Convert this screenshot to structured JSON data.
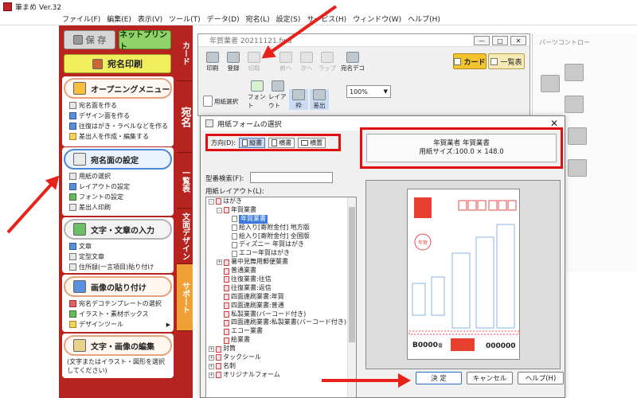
{
  "app": {
    "title": "筆まめ Ver.32"
  },
  "menu": [
    "ファイル(F)",
    "編集(E)",
    "表示(V)",
    "ツール(T)",
    "データ(D)",
    "宛名(L)",
    "設定(S)",
    "サービス(H)",
    "ウィンドウ(W)",
    "ヘルプ(H)"
  ],
  "left_panel": {
    "save_label": "保 存",
    "netprint_label": "ネットプリント",
    "address_print_label": "宛名印刷",
    "sections": [
      {
        "header": "オープニングメニュー",
        "items": [
          "宛名面を作る",
          "デザイン面を作る",
          "往復はがき・ラベルなどを作る",
          "差出人を作成・編集する"
        ]
      },
      {
        "header": "宛名面の設定",
        "items": [
          "用紙の選択",
          "レイアウトの設定",
          "フォントの設定",
          "差出人印刷"
        ]
      },
      {
        "header": "文字・文章の入力",
        "items": [
          "文章",
          "定型文章",
          "住所録(一言項目)貼り付け"
        ]
      },
      {
        "header": "画像の貼り付け",
        "items": [
          "宛名デコテンプレートの選択",
          "イラスト・素材ボックス",
          "デザインツール"
        ]
      },
      {
        "header": "文字・画像の編集",
        "note": "(文字またはイラスト・図形を選択してください)"
      }
    ]
  },
  "vertical_tabs": [
    "カード",
    "宛名",
    "一覧表",
    "文面デザイン",
    "サポート"
  ],
  "card_window": {
    "title": "年賀業者 20211121.fwa",
    "toolbar_row1": [
      "印刷",
      "登録",
      "切取",
      "前へ",
      "次へ",
      "ラップ",
      "宛名デコ"
    ],
    "card_tab": "カード",
    "list_tab": "一覧表",
    "toolbar_row2": [
      "用紙選択",
      "フォント",
      "レイアウト",
      "枠",
      "差出"
    ],
    "zoom": "100%"
  },
  "parts_panel": {
    "title": "パーツコントロー"
  },
  "dialog": {
    "title": "用紙フォームの選択",
    "orientation_label": "方向(D):",
    "orientation_options": [
      "縦書",
      "横書",
      "横置"
    ],
    "info_line1": "年賀業者 年賀業書",
    "info_line2": "用紙サイズ:100.0 × 148.0",
    "search_label": "型番検索(F):",
    "search_value": "",
    "layout_label": "用紙レイアウト(L):",
    "tree": [
      {
        "text": "はがき",
        "level": 0,
        "toggle": "-"
      },
      {
        "text": "年賀業書",
        "level": 1,
        "toggle": "-"
      },
      {
        "text": "年賀業書",
        "level": 2,
        "selected": true
      },
      {
        "text": "絵入り[寄附金付] 地方版",
        "level": 2
      },
      {
        "text": "絵入り[寄附金付] 全国版",
        "level": 2
      },
      {
        "text": "ディズニー 年賀はがき",
        "level": 2
      },
      {
        "text": "エコー年賀はがき",
        "level": 2
      },
      {
        "text": "暑中見舞用郵便葉書",
        "level": 1,
        "toggle": "+"
      },
      {
        "text": "普通業書",
        "level": 1
      },
      {
        "text": "往復業書:往信",
        "level": 1
      },
      {
        "text": "往復業書:返信",
        "level": 1
      },
      {
        "text": "四面連刷業書:年賀",
        "level": 1
      },
      {
        "text": "四面連刷業書:普通",
        "level": 1
      },
      {
        "text": "私製業書(バーコード付き)",
        "level": 1
      },
      {
        "text": "四面連刷業書:私製業書(バーコード付き)",
        "level": 1
      },
      {
        "text": "エコー業書",
        "level": 1
      },
      {
        "text": "絵業書",
        "level": 1
      },
      {
        "text": "封筒",
        "level": 0,
        "toggle": "+"
      },
      {
        "text": "タックシール",
        "level": 0,
        "toggle": "+"
      },
      {
        "text": "名刺",
        "level": 0,
        "toggle": "+"
      },
      {
        "text": "オリジナルフォーム",
        "level": 0,
        "toggle": "+"
      }
    ],
    "postcard_preview": {
      "sender_code": "B0000",
      "sender_suffix": "番",
      "code_right": "000000",
      "stamp": "年賀"
    },
    "buttons": {
      "ok": "決 定",
      "cancel": "キャンセル",
      "help": "ヘルプ(H)"
    }
  },
  "colors": {
    "panel_red": "#b7231e",
    "highlight_red": "#e01010",
    "select_blue": "#3879d9"
  }
}
